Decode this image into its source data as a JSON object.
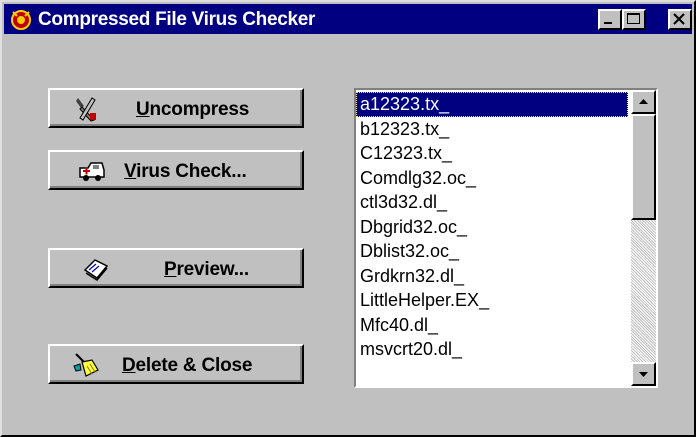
{
  "window": {
    "title": "Compressed File Virus Checker",
    "colors": {
      "titlebar": "#000080",
      "face": "#c0c0c0",
      "selection": "#000080"
    }
  },
  "titlebar_buttons": {
    "minimize": "minimize-icon",
    "maximize": "maximize-icon",
    "close": "close-icon"
  },
  "buttons": {
    "uncompress": {
      "mnemonic": "U",
      "rest": "ncompress",
      "icon": "tools-icon"
    },
    "virus_check": {
      "mnemonic": "V",
      "rest": "irus Check...",
      "icon": "ambulance-icon"
    },
    "preview": {
      "mnemonic": "P",
      "rest": "review...",
      "icon": "book-icon"
    },
    "delete_close": {
      "mnemonic": "D",
      "rest": "elete & Close",
      "icon": "broom-icon"
    }
  },
  "file_list": {
    "selected_index": 0,
    "items": [
      "a12323.tx_",
      "b12323.tx_",
      "C12323.tx_",
      "Comdlg32.oc_",
      "ctl3d32.dl_",
      "Dbgrid32.oc_",
      "Dblist32.oc_",
      "Grdkrn32.dl_",
      "LittleHelper.EX_",
      "Mfc40.dl_",
      "msvcrt20.dl_"
    ]
  }
}
